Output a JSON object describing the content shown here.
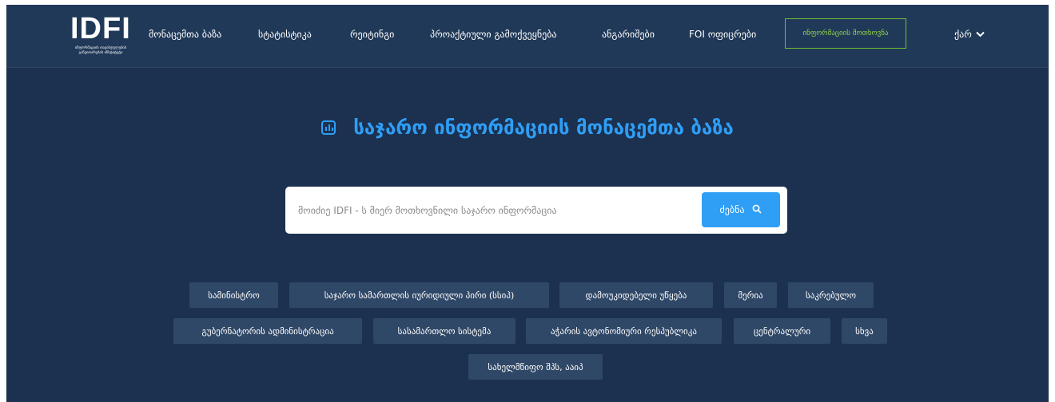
{
  "logo": {
    "mark": "IDFI",
    "subtitle": "ინფორმაციის თავისუფლების განვითარების ინსტიტუტი"
  },
  "nav": {
    "items": [
      "მონაცემთა ბაზა",
      "სტატისტიკა",
      "რეიტინგი",
      "პროაქტიული გამოქვეყნება",
      "ანგარიშები",
      "FOI ოფიცრები"
    ],
    "request_button": "ინფორმაციის მოთხოვნა",
    "language": "ქარ"
  },
  "hero": {
    "title": "საჯარო ინფორმაციის მონაცემთა ბაზა"
  },
  "search": {
    "placeholder": "მოიძიე IDFI - ს მიერ მოთხოვნილი საჯარო ინფორმაცია",
    "value": "",
    "button_label": "ძებნა"
  },
  "tags": {
    "row1": [
      "სამინისტრო",
      "საჯარო სამართლის იურიდიული პირი (სსიპ)",
      "დამოუკიდებელი უწყება",
      "მერია",
      "საკრებულო"
    ],
    "row2": [
      "გუბერნატორის ადმინისტრაცია",
      "სასამართლო სისტემა",
      "აჭარის ავტონომიური რესპუბლიკა",
      "ცენტრალური",
      "სხვა"
    ],
    "row3": [
      "სახელმწიფო შპს, ააიპ"
    ]
  },
  "colors": {
    "background": "#1c3150",
    "navbar": "#213958",
    "accent": "#2f9ef5",
    "request_border": "#6fbf2f",
    "tag": "#304867"
  },
  "icons": {
    "hero": "chart-icon",
    "search": "search-icon",
    "language": "chevron-down-icon"
  }
}
